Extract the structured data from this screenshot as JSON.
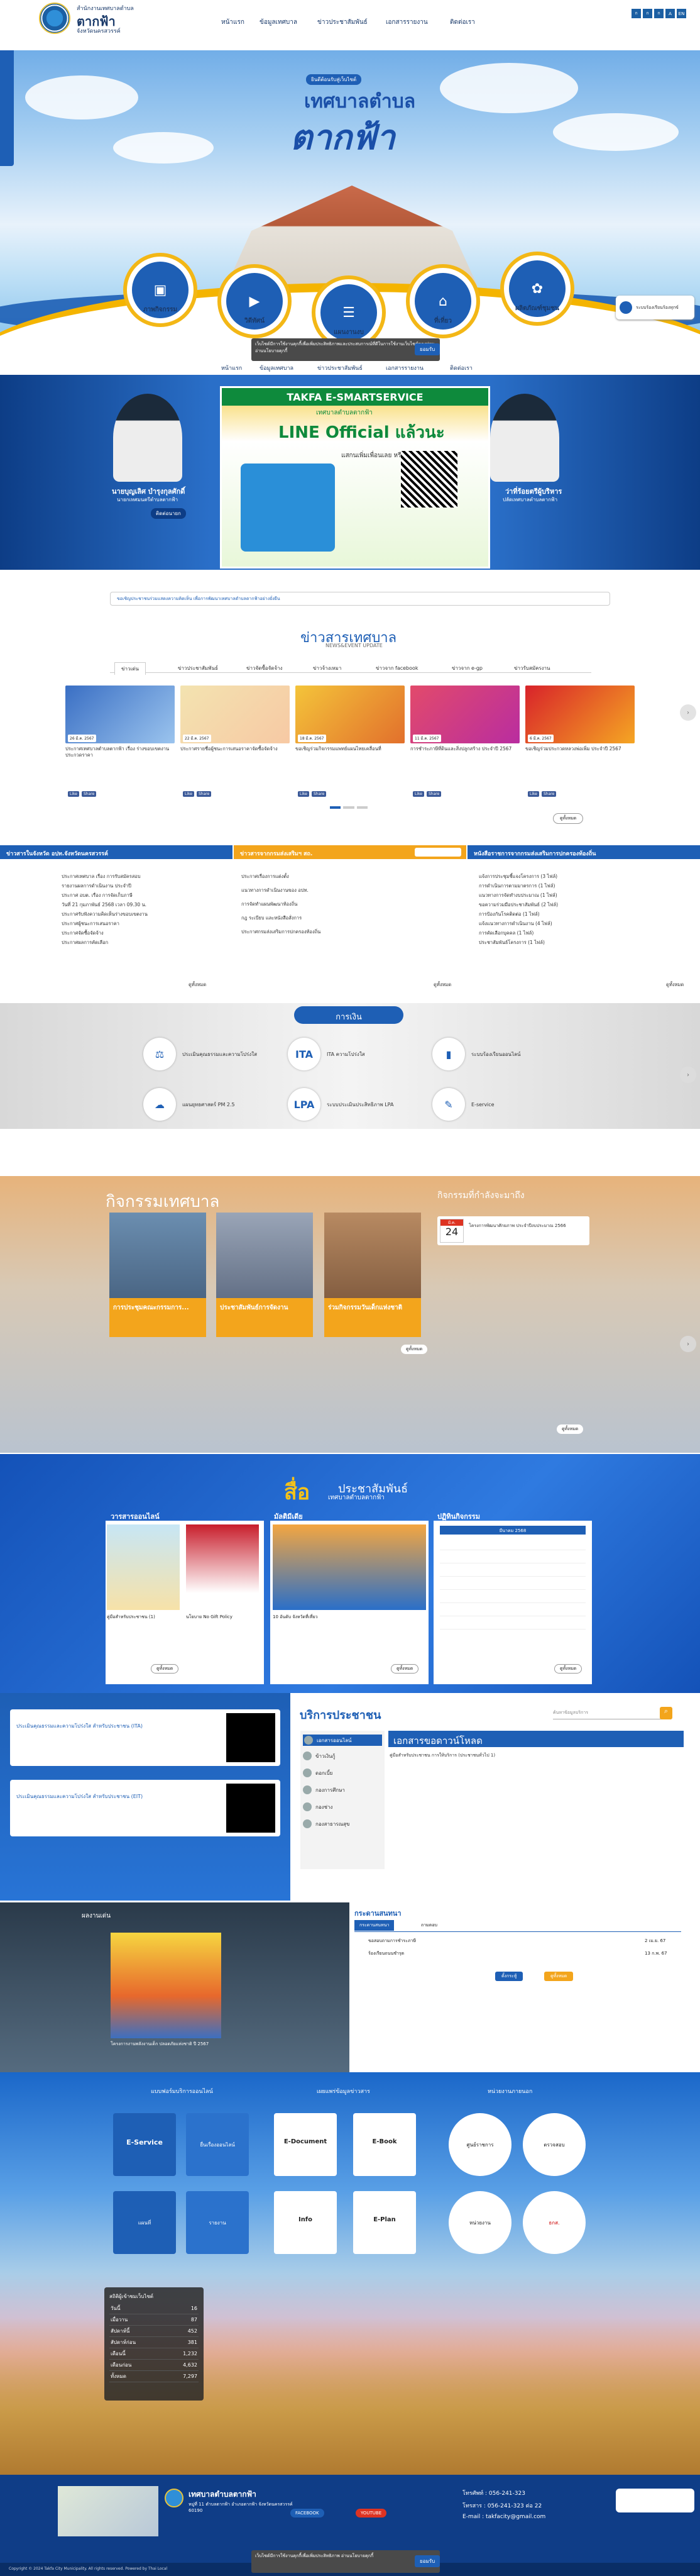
{
  "header": {
    "org_top": "สำนักงานเทศบาลตำบล",
    "org_name": "ตากฟ้า",
    "org_prov": "จังหวัดนครสวรรค์",
    "nav": [
      "หน้าแรก",
      "ข้อมูลเทศบาล",
      "ข่าวประชาสัมพันธ์",
      "เอกสารรายงาน",
      "ติดต่อเรา"
    ],
    "toolbar": [
      "ก",
      "ก",
      "ก",
      "A",
      "EN"
    ]
  },
  "hero": {
    "subtitle": "ยินดีต้อนรับสู่เว็บไซต์",
    "title1": "เทศบาลตำบล",
    "title2": "ตากฟ้า",
    "circles": [
      "ภาพกิจกรรม",
      "วิดีทัศน์",
      "แผนงานงบ",
      "ที่เที่ยว",
      "ผลิตภัณฑ์ชุมชน"
    ],
    "widget": "ระบบร้องเรียนร้องทุกข์",
    "cookie": "เว็บไซต์มีการใช้งานคุกกี้เพื่อเพิ่มประสิทธิภาพและประสบการณ์ที่ดีในการใช้งานเว็บไซต์ของท่าน อ่านนโยบายคุกกี้",
    "cookie_ok": "ยอมรับ"
  },
  "banner": {
    "left_name": "นายบุญเลิศ บำรุงกุลศักดิ์",
    "left_role": "นายกเทศมนตรีตำบลตากฟ้า",
    "right_name": "ว่าที่ร้อยตรีผู้บริหาร",
    "right_role": "ปลัดเทศบาลตำบลตากฟ้า",
    "promo_head": "TAKFA E-SMARTSERVICE",
    "promo_sub": "เทศบาลตำบลตากฟ้า",
    "promo_line": "LINE Official แล้วนะ",
    "promo_cta": "แสกนเพิ่มเพื่อนเลย หรือ",
    "left_btn": "ติดต่อนายก",
    "quick_text": "ขอเชิญประชาชนร่วมแสดงความคิดเห็น เพื่อการพัฒนาเทศบาลตำบลตากฟ้าอย่างยั่งยืน"
  },
  "news": {
    "title": "ข่าวสารเทศบาล",
    "subtitle": "NEWS&EVENT UPDATE",
    "tabs": [
      "ข่าวเด่น",
      "ข่าวประชาสัมพันธ์",
      "ข่าวจัดซื้อจัดจ้าง",
      "ข่าวจ้างเหมา",
      "ข่าวจาก facebook",
      "ข่าวจาก e-gp",
      "ข่าวรับสมัครงาน"
    ],
    "cards": [
      {
        "text": "ประกาศเทศบาลตำบลตากฟ้า เรื่อง ร่างขอบเขตงานประกวดราคา",
        "date": "26 มี.ค. 2567"
      },
      {
        "text": "ประกาศรายชื่อผู้ชนะการเสนอราคาจัดซื้อจัดจ้าง",
        "date": "22 มี.ค. 2567"
      },
      {
        "text": "ขอเชิญร่วมกิจกรรมแพทย์แผนไทยเคลื่อนที่",
        "date": "18 มี.ค. 2567"
      },
      {
        "text": "การชำระภาษีที่ดินและสิ่งปลูกสร้าง ประจำปี 2567",
        "date": "11 มี.ค. 2567"
      },
      {
        "text": "ขอเชิญร่วมประกวดหลวงพ่อเพิ่ม ประจำปี 2567",
        "date": "6 มี.ค. 2567"
      }
    ],
    "share": [
      "Like",
      "Share"
    ],
    "more": "ดูทั้งหมด"
  },
  "columns": [
    {
      "title": "ข่าวสารในจังหวัด อปท.จังหวัดนครสวรรค์",
      "color": "#1e5fb5",
      "rows": [
        "ประกาศเทศบาล เรื่อง การรับสมัครสอบ",
        "รายงานผลการดำเนินงาน ประจำปี",
        "ประกาศ อบต. เรื่อง การจัดเก็บภาษี",
        "วันที่ 21 กุมภาพันธ์ 2568 เวลา 09.30 น.",
        "ประกาศรับฟังความคิดเห็นร่างขอบเขตงาน",
        "ประกาศผู้ชนะการเสนอราคา",
        "ประกาศจัดซื้อจัดจ้าง",
        "ประกาศผลการคัดเลือก"
      ],
      "more": "ดูทั้งหมด"
    },
    {
      "title": "ข่าวสารจากกรมส่งเสริมฯ สถ.",
      "color": "#f3a51c",
      "rows": [
        "ประกาศเรื่องการแต่งตั้ง",
        "แนวทางการดำเนินงานของ อปท.",
        "การจัดทำแผนพัฒนาท้องถิ่น",
        "กฎ ระเบียบ และหนังสือสั่งการ",
        "ประกาศกรมส่งเสริมการปกครองท้องถิ่น"
      ],
      "more": "ดูทั้งหมด"
    },
    {
      "title": "หนังสือราชการจากกรมส่งเสริมการปกครองท้องถิ่น",
      "color": "#1e5fb5",
      "rows": [
        "แจ้งการประชุมชี้แจงโครงการ (3 ไฟล์)",
        "การดำเนินการตามมาตรการ (1 ไฟล์)",
        "แนวทางการจัดทำงบประมาณ (1 ไฟล์)",
        "ขอความร่วมมือประชาสัมพันธ์ (2 ไฟล์)",
        "การป้องกันโรคติดต่อ (1 ไฟล์)",
        "แจ้งแนวทางการดำเนินงาน (4 ไฟล์)",
        "การคัดเลือกบุคคล (1 ไฟล์)",
        "ประชาสัมพันธ์โครงการ (1 ไฟล์)"
      ],
      "more": "ดูทั้งหมด"
    }
  ],
  "eservice": {
    "title": "การเงิน",
    "items": [
      "ประเมินคุณธรรมและความโปร่งใส",
      "ITA ความโปร่งใส",
      "ระบบร้องเรียนออนไลน์",
      "แผนยุทธศาสตร์ PM 2.5",
      "ระบบประเมินประสิทธิภาพ LPA",
      "E-service"
    ]
  },
  "activities": {
    "title": "กิจกรรมเทศบาล",
    "cards": [
      "การประชุมคณะกรรมการ...",
      "ประชาสัมพันธ์การจัดงาน",
      "ร่วมกิจกรรมวันเด็กแห่งชาติ"
    ],
    "upcoming_title": "กิจกรรมที่กำลังจะมาถึง",
    "upcoming_day": "24",
    "upcoming_month": "มี.ค.",
    "upcoming_text": "โครงการพัฒนาศักยภาพ ประจำปีงบประมาณ 2566",
    "more": "ดูทั้งหมด"
  },
  "pr": {
    "title": "สื่อ",
    "title2": "ประชาสัมพันธ์",
    "subtitle": "เทศบาลตำบลตากฟ้า",
    "boxes": [
      "วารสารออนไลน์",
      "มัลติมีเดีย",
      "ปฏิทินกิจกรรม"
    ],
    "captions": [
      "คู่มือสำหรับประชาชน (1)",
      "นโยบาย No Gift Policy",
      "10 อันดับ จังหวัดที่เที่ยว"
    ],
    "calendar_month": "มีนาคม 2568",
    "more": "ดูทั้งหมด"
  },
  "service": {
    "title": "บริการประชาชน",
    "search_placeholder": "ค้นหาข้อมูลบริการ",
    "menu": [
      "เอกสารออนไลน์",
      "ข้าวเงินกู้",
      "ดอกเบี้ย",
      "กองการศึกษา",
      "กองช่าง",
      "กองสาธารณสุข"
    ],
    "doc_title": "เอกสารขอดาวน์โหลด",
    "qr": [
      "ประเมินคุณธรรมและความโปร่งใส สำหรับประชาชน (ITA)",
      "ประเมินคุณธรรมและความโปร่งใส สำหรับประชาชน (EIT)"
    ],
    "doc_row": "คู่มือสำหรับประชาชน การให้บริการ (ประชาชนทั่วไป 1)"
  },
  "board": {
    "video_title": "ผลงานเด่น",
    "video_caption": "โครงการงานพลังงานเด็ก ปลอดภัยแห่งชาติ ปี 2567",
    "title": "กระดานสนทนา",
    "tabs": [
      "กระดานสนทนา",
      "ถามตอบ"
    ],
    "rows": [
      {
        "q": "ขอสอบถามการชำระภาษี",
        "d": "2 เม.ย. 67"
      },
      {
        "q": "ร้องเรียนถนนชำรุด",
        "d": "13 ก.พ. 67"
      }
    ],
    "btn1": "ตั้งกระทู้",
    "btn2": "ดูทั้งหมด"
  },
  "links": {
    "titles": [
      "แบบฟอร์มบริการออนไลน์",
      "เผยแพร่ข้อมูลข่าวสาร",
      "หน่วยงานภายนอก"
    ],
    "items": [
      "E-Service",
      "ยื่นเรื่องออนไลน์",
      "E-Document",
      "E-Book",
      "ศูนย์ราชการ",
      "ตรวจสอบ",
      "แผนที่",
      "รายงาน",
      "Info",
      "E-Plan",
      "หน่วยงาน",
      "ธกส."
    ]
  },
  "visitors": {
    "title": "สถิติผู้เข้าชมเว็บไซต์",
    "rows": [
      [
        "วันนี้",
        "16"
      ],
      [
        "เมื่อวาน",
        "87"
      ],
      [
        "สัปดาห์นี้",
        "452"
      ],
      [
        "สัปดาห์ก่อน",
        "381"
      ],
      [
        "เดือนนี้",
        "1,232"
      ],
      [
        "เดือนก่อน",
        "4,632"
      ],
      [
        "ทั้งหมด",
        "7,297"
      ]
    ]
  },
  "footer": {
    "name": "เทศบาลตำบลตากฟ้า",
    "address": "หมู่ที่ 11 ตำบลตากฟ้า อำเภอตากฟ้า จังหวัดนครสวรรค์ 60190",
    "phone": "โทรศัพท์ : 056-241-323",
    "fax": "โทรสาร : 056-241-323 ต่อ 22",
    "email": "E-mail : takfacity@gmail.com",
    "facebook": "FACEBOOK",
    "youtube": "YOUTUBE",
    "copy": "Copyright © 2024 Takfa City Municipality. All rights reserved. Powered by Thai Local",
    "cookie": "เว็บไซต์มีการใช้งานคุกกี้เพื่อเพิ่มประสิทธิภาพ อ่านนโยบายคุกกี้",
    "cookie_ok": "ยอมรับ"
  }
}
